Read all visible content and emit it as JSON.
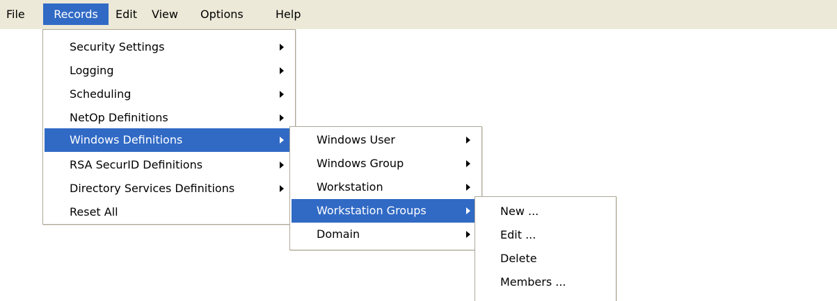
{
  "menubar": {
    "items": [
      "File",
      "Records",
      "Edit",
      "View",
      "Options",
      "Help"
    ]
  },
  "records_menu": {
    "items": [
      "Security Settings",
      "Logging",
      "Scheduling",
      "NetOp Definitions",
      "Windows Definitions",
      "RSA SecurID Definitions",
      "Directory Services Definitions",
      "Reset All"
    ]
  },
  "windows_definitions_menu": {
    "items": [
      "Windows User",
      "Windows Group",
      "Workstation",
      "Workstation Groups",
      "Domain"
    ]
  },
  "workstation_groups_menu": {
    "items": [
      "New ...",
      "Edit ...",
      "Delete",
      "Members ..."
    ]
  },
  "colors": {
    "menubar_bg": "#ece9d8",
    "highlight": "#316ac5",
    "menu_border": "#aca899"
  },
  "icons": [
    "submenu-arrow-icon"
  ]
}
